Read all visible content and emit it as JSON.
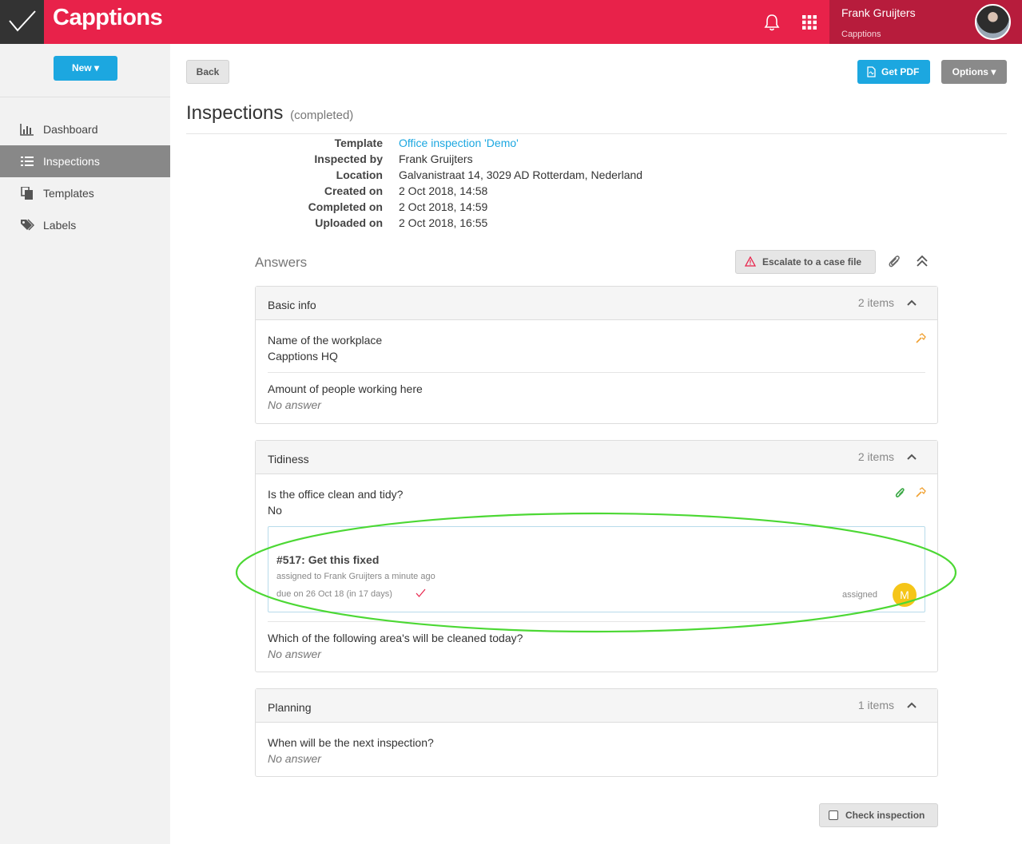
{
  "header": {
    "brand": "Capptions",
    "user_name": "Frank Gruijters",
    "user_org": "Capptions"
  },
  "sidebar": {
    "new_label": "New",
    "items": [
      {
        "label": "Dashboard",
        "icon": "bar-chart-icon"
      },
      {
        "label": "Inspections",
        "icon": "list-icon",
        "active": true
      },
      {
        "label": "Templates",
        "icon": "copy-icon"
      },
      {
        "label": "Labels",
        "icon": "tags-icon"
      }
    ]
  },
  "toolbar": {
    "back_label": "Back",
    "pdf_label": "Get PDF",
    "options_label": "Options"
  },
  "page": {
    "title": "Inspections",
    "subtitle": "(completed)"
  },
  "meta": {
    "template_label": "Template",
    "template_value": "Office inspection 'Demo'",
    "inspected_by_label": "Inspected by",
    "inspected_by_value": "Frank Gruijters",
    "location_label": "Location",
    "location_value": "Galvanistraat 14, 3029 AD Rotterdam, Nederland",
    "created_label": "Created on",
    "created_value": "2 Oct 2018, 14:58",
    "completed_label": "Completed on",
    "completed_value": "2 Oct 2018, 14:59",
    "uploaded_label": "Uploaded on",
    "uploaded_value": "2 Oct 2018, 16:55"
  },
  "answers": {
    "title": "Answers",
    "escalate_label": "Escalate to a case file"
  },
  "sections": [
    {
      "title": "Basic info",
      "count": "2 items",
      "items": [
        {
          "question": "Name of the workplace",
          "answer": "Capptions HQ"
        },
        {
          "question": "Amount of people working here",
          "answer": "No answer"
        }
      ]
    },
    {
      "title": "Tidiness",
      "count": "2 items",
      "items": [
        {
          "question": "Is the office clean and tidy?",
          "answer": "No"
        },
        {
          "question": "Which of the following area's will be cleaned today?",
          "answer": "No answer"
        }
      ]
    },
    {
      "title": "Planning",
      "count": "1 items",
      "items": [
        {
          "question": "When will be the next inspection?",
          "answer": "No answer"
        }
      ]
    }
  ],
  "task": {
    "title": "#517: Get this fixed",
    "assigned": "assigned to Frank Gruijters a minute ago",
    "due": "due on 26 Oct 18 (in 17 days)",
    "status": "assigned",
    "avatar_initial": "M"
  },
  "footer": {
    "check_label": "Check inspection"
  },
  "colors": {
    "brand_red": "#e8224a",
    "accent_blue": "#1ca7e0",
    "highlight_green": "#4cd834"
  }
}
